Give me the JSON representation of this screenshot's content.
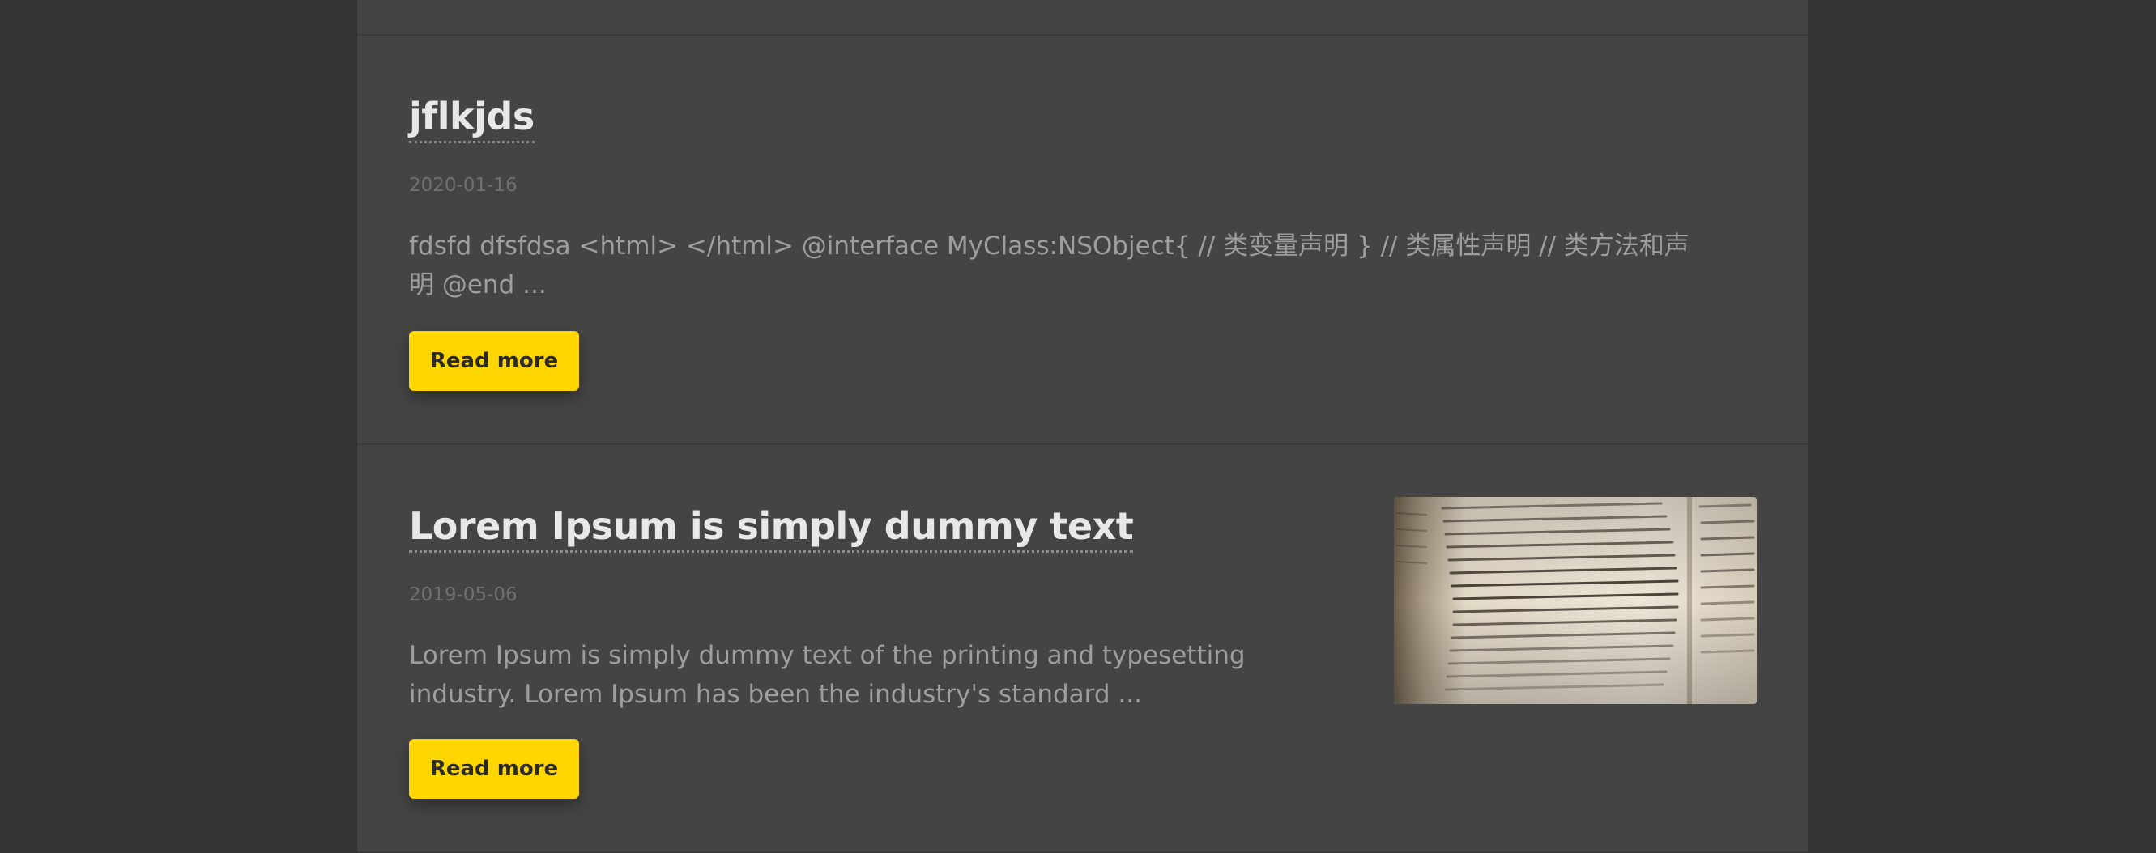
{
  "posts": [
    {
      "title": "jflkjds",
      "date": "2020-01-16",
      "excerpt": "fdsfd dfsfdsa <html> </html> @interface MyClass:NSObject{ // 类变量声明 } // 类属性声明 // 类方法和声明 @end ...",
      "read_more_label": "Read more",
      "has_thumbnail": false
    },
    {
      "title": "Lorem Ipsum is simply dummy text",
      "date": "2019-05-06",
      "excerpt": "Lorem Ipsum is simply dummy text of the printing and typesetting industry. Lorem Ipsum has been the industry's standard ...",
      "read_more_label": "Read more",
      "has_thumbnail": true,
      "thumbnail_icon": "dictionary-page-image"
    }
  ],
  "colors": {
    "page_background": "#333333",
    "column_background": "#444444",
    "accent": "#ffd600",
    "title_text": "#e8e8e8",
    "date_text": "#6f6f6f",
    "excerpt_text": "#9e9e9e"
  }
}
